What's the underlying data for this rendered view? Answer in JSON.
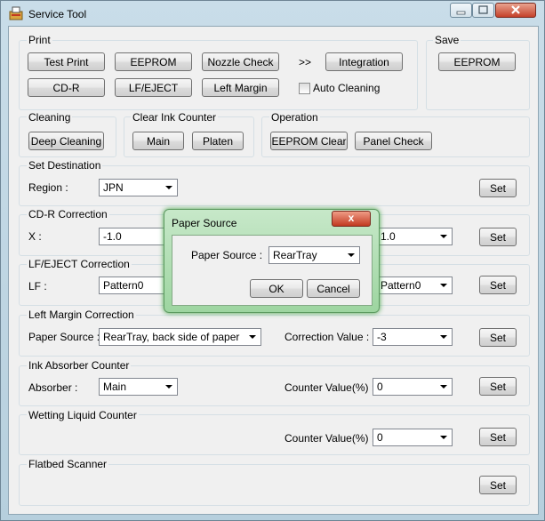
{
  "window": {
    "title": "Service Tool"
  },
  "print": {
    "label": "Print",
    "buttons": [
      "Test Print",
      "EEPROM",
      "Nozzle Check",
      "CD-R",
      "LF/EJECT",
      "Left Margin"
    ],
    "arrow": ">>",
    "integration": "Integration",
    "auto_cleaning": "Auto Cleaning"
  },
  "save": {
    "label": "Save",
    "eeprom": "EEPROM"
  },
  "cleaning": {
    "label": "Cleaning",
    "deep": "Deep Cleaning"
  },
  "clear_ink": {
    "label": "Clear Ink Counter",
    "main": "Main",
    "platen": "Platen"
  },
  "operation": {
    "label": "Operation",
    "eeprom_clear": "EEPROM Clear",
    "panel_check": "Panel Check"
  },
  "set_destination": {
    "label": "Set Destination",
    "region_label": "Region :",
    "region_value": "JPN",
    "set": "Set"
  },
  "cdr": {
    "label": "CD-R Correction",
    "x_label": "X :",
    "x_value": "-1.0",
    "y_value": "1.0",
    "set": "Set"
  },
  "lfeject": {
    "label": "LF/EJECT Correction",
    "lf_label": "LF :",
    "lf_value": "Pattern0",
    "eject_value": "Pattern0",
    "set": "Set"
  },
  "left_margin": {
    "label": "Left Margin Correction",
    "paper_label": "Paper Source :",
    "paper_value": "RearTray, back side of paper",
    "corr_label": "Correction Value :",
    "corr_value": "-3",
    "set": "Set"
  },
  "ink_absorber": {
    "label": "Ink Absorber Counter",
    "absorber_label": "Absorber :",
    "absorber_value": "Main",
    "counter_label": "Counter Value(%) :",
    "counter_value": "0",
    "set": "Set"
  },
  "wetting": {
    "label": "Wetting Liquid Counter",
    "counter_label": "Counter Value(%) :",
    "counter_value": "0",
    "set": "Set"
  },
  "flatbed": {
    "label": "Flatbed Scanner",
    "set": "Set"
  },
  "dialog": {
    "title": "Paper Source",
    "close": "x",
    "paper_label": "Paper Source :",
    "paper_value": "RearTray",
    "ok": "OK",
    "cancel": "Cancel"
  },
  "colors": {
    "window_frame": "#b9d1e0",
    "dialog_frame": "#9dd5a0",
    "close_button": "#c4412a"
  }
}
